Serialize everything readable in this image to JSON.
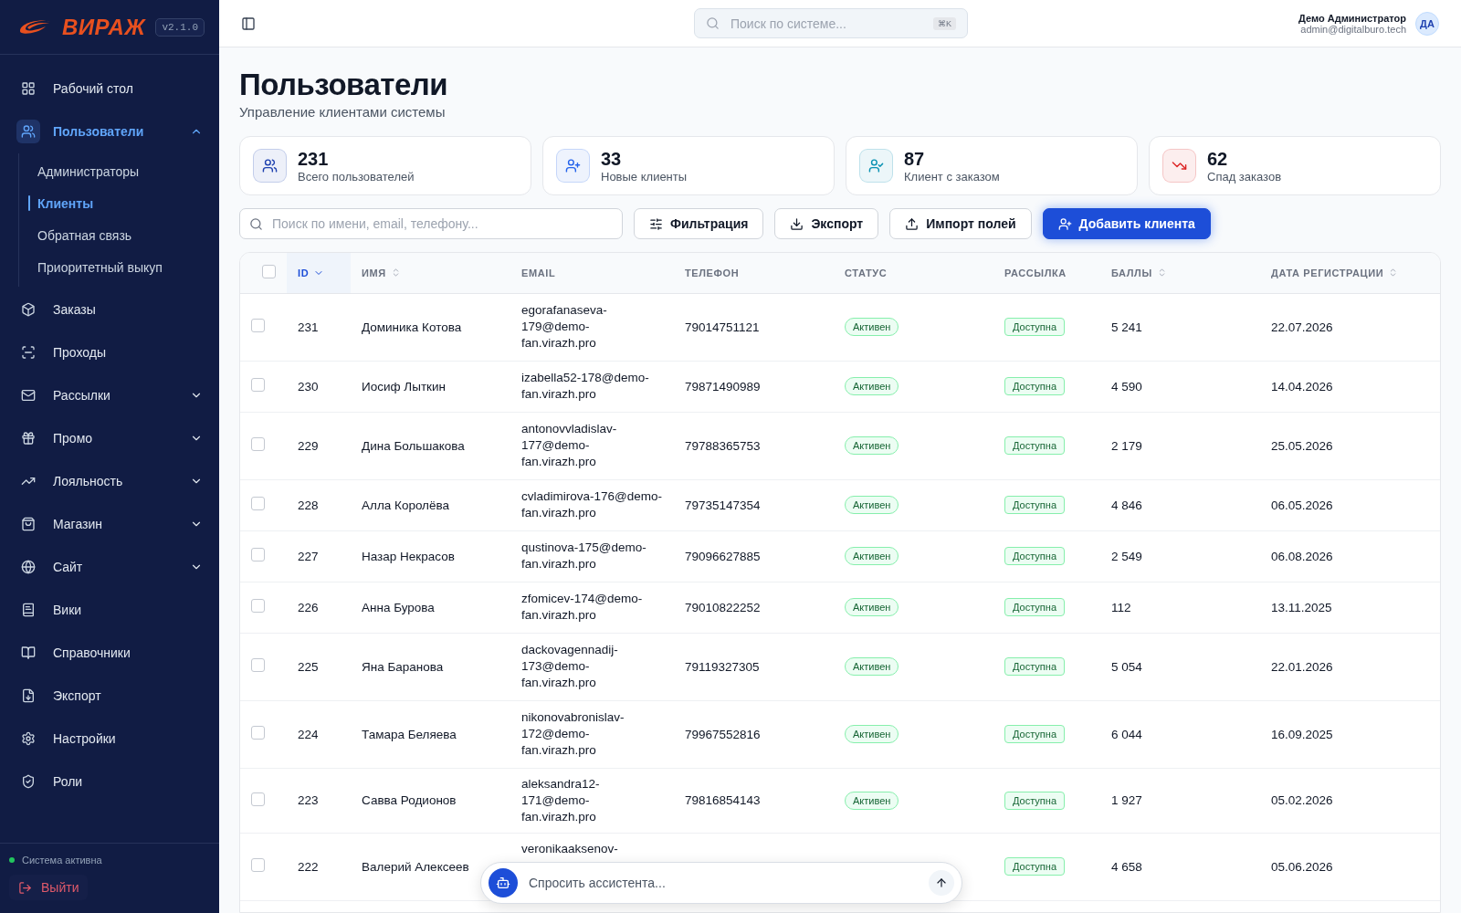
{
  "brand": {
    "logo": "ВИРАЖ",
    "version": "v2.1.0"
  },
  "sidebar": {
    "items": [
      {
        "label": "Рабочий стол",
        "selected": false
      },
      {
        "label": "Пользователи",
        "selected": true,
        "expanded": true,
        "children": [
          {
            "label": "Администраторы",
            "selected": false
          },
          {
            "label": "Клиенты",
            "selected": true
          },
          {
            "label": "Обратная связь",
            "selected": false
          },
          {
            "label": "Приоритетный выкуп",
            "selected": false
          }
        ]
      },
      {
        "label": "Заказы",
        "selected": false
      },
      {
        "label": "Проходы",
        "selected": false
      },
      {
        "label": "Рассылки",
        "selected": false,
        "expanded": false
      },
      {
        "label": "Промо",
        "selected": false,
        "expanded": false
      },
      {
        "label": "Лояльность",
        "selected": false,
        "expanded": false
      },
      {
        "label": "Магазин",
        "selected": false,
        "expanded": false
      },
      {
        "label": "Сайт",
        "selected": false,
        "expanded": false
      },
      {
        "label": "Вики",
        "selected": false
      },
      {
        "label": "Справочники",
        "selected": false
      },
      {
        "label": "Экспорт",
        "selected": false
      },
      {
        "label": "Настройки",
        "selected": false
      },
      {
        "label": "Роли",
        "selected": false
      }
    ],
    "status": {
      "label": "Система активна",
      "color": "#22c55e"
    },
    "logout": "Выйти"
  },
  "header": {
    "search": {
      "placeholder": "Поиск по системе...",
      "shortcut": "⌘K"
    },
    "user": {
      "name": "Демо Администратор",
      "email": "admin@digitalburo.tech",
      "initials": "ДА"
    }
  },
  "page": {
    "title": "Пользователи",
    "subtitle": "Управление клиентами системы"
  },
  "stats": [
    {
      "value": "231",
      "label": "Всего пользователей",
      "color": "#1e40af"
    },
    {
      "value": "33",
      "label": "Новые клиенты",
      "color": "#2563eb"
    },
    {
      "value": "87",
      "label": "Клиент с заказом",
      "color": "#0891b2"
    },
    {
      "value": "62",
      "label": "Спад заказов",
      "color": "#dc2626"
    }
  ],
  "toolbar": {
    "search": {
      "placeholder": "Поиск по имени, email, телефону..."
    },
    "buttons": [
      {
        "kind": "filter",
        "label": "Фильтрация"
      },
      {
        "kind": "export",
        "label": "Экспорт"
      },
      {
        "kind": "import",
        "label": "Импорт полей"
      },
      {
        "kind": "add",
        "label": "Добавить клиента"
      }
    ]
  },
  "table": {
    "all_checked": false,
    "columns": [
      {
        "label": "ID",
        "sorted": true
      },
      {
        "label": "ИМЯ",
        "sorted": false
      },
      {
        "label": "EMAIL"
      },
      {
        "label": "ТЕЛЕФОН"
      },
      {
        "label": "СТАТУС"
      },
      {
        "label": "РАССЫЛКА"
      },
      {
        "label": "БАЛЛЫ",
        "sorted": false
      },
      {
        "label": "ДАТА РЕГИСТРАЦИИ",
        "sorted": false
      }
    ],
    "rows": [
      {
        "checked": false,
        "id": "231",
        "name": "Доминика Котова",
        "email": "egorafanaseva-179@demo-fan.virazh.pro",
        "phone": "79014751121",
        "status": "Активен",
        "mailing": "Доступна",
        "points": "5 241",
        "date": "22.07.2026"
      },
      {
        "checked": false,
        "id": "230",
        "name": "Иосиф Лыткин",
        "email": "izabella52-178@demo-fan.virazh.pro",
        "phone": "79871490989",
        "status": "Активен",
        "mailing": "Доступна",
        "points": "4 590",
        "date": "14.04.2026"
      },
      {
        "checked": false,
        "id": "229",
        "name": "Дина Большакова",
        "email": "antonovvladislav-177@demo-fan.virazh.pro",
        "phone": "79788365753",
        "status": "Активен",
        "mailing": "Доступна",
        "points": "2 179",
        "date": "25.05.2026"
      },
      {
        "checked": false,
        "id": "228",
        "name": "Алла Королёва",
        "email": "cvladimirova-176@demo-fan.virazh.pro",
        "phone": "79735147354",
        "status": "Активен",
        "mailing": "Доступна",
        "points": "4 846",
        "date": "06.05.2026"
      },
      {
        "checked": false,
        "id": "227",
        "name": "Назар Некрасов",
        "email": "qustinova-175@demo-fan.virazh.pro",
        "phone": "79096627885",
        "status": "Активен",
        "mailing": "Доступна",
        "points": "2 549",
        "date": "06.08.2026"
      },
      {
        "checked": false,
        "id": "226",
        "name": "Анна Бурова",
        "email": "zfomicev-174@demo-fan.virazh.pro",
        "phone": "79010822252",
        "status": "Активен",
        "mailing": "Доступна",
        "points": "112",
        "date": "13.11.2025"
      },
      {
        "checked": false,
        "id": "225",
        "name": "Яна Баранова",
        "email": "dackovagennadij-173@demo-fan.virazh.pro",
        "phone": "79119327305",
        "status": "Активен",
        "mailing": "Доступна",
        "points": "5 054",
        "date": "22.01.2026"
      },
      {
        "checked": false,
        "id": "224",
        "name": "Тамара Беляева",
        "email": "nikonovabronislav-172@demo-fan.virazh.pro",
        "phone": "79967552816",
        "status": "Активен",
        "mailing": "Доступна",
        "points": "6 044",
        "date": "16.09.2025"
      },
      {
        "checked": false,
        "id": "223",
        "name": "Савва Родионов",
        "email": "aleksandra12-171@demo-fan.virazh.pro",
        "phone": "79816854143",
        "status": "Активен",
        "mailing": "Доступна",
        "points": "1 927",
        "date": "05.02.2026"
      },
      {
        "checked": false,
        "id": "222",
        "name": "Валерий Алексеев",
        "email": "veronikaaksenov-",
        "mailing": "Доступна",
        "points": "4 658",
        "date": "05.06.2026"
      }
    ]
  },
  "assistant": {
    "placeholder": "Спросить ассистента..."
  }
}
